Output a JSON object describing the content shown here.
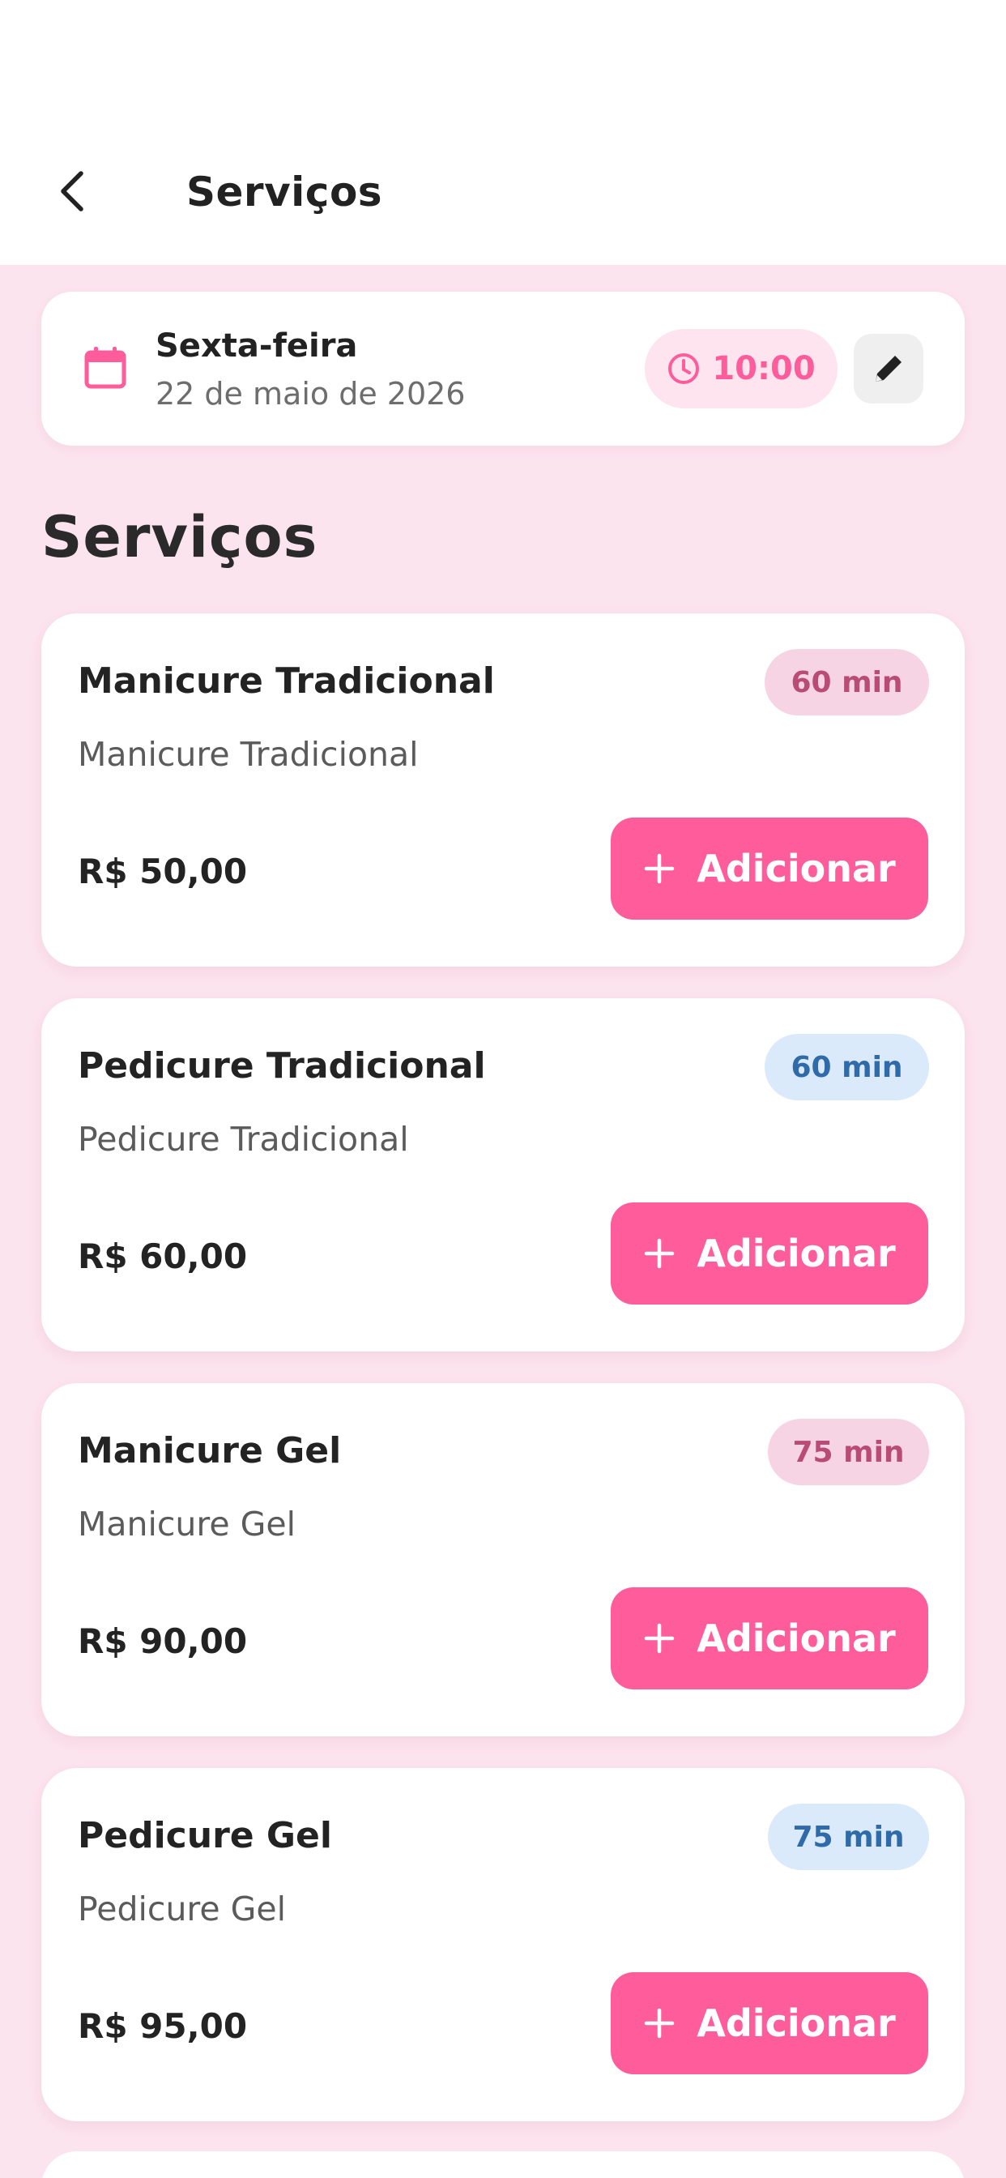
{
  "header": {
    "title": "Serviços",
    "back_icon": "chevron-left-icon"
  },
  "date_card": {
    "weekday": "Sexta-feira",
    "date": "22 de maio de 2026",
    "time": "10:00",
    "calendar_icon": "calendar-icon",
    "clock_icon": "clock-icon",
    "edit_icon": "pencil-icon"
  },
  "section_title": "Serviços",
  "services": [
    {
      "name": "Manicure Tradicional",
      "description": "Manicure Tradicional",
      "duration": "60 min",
      "duration_style": "pink",
      "price": "R$ 50,00",
      "button_label": "Adicionar"
    },
    {
      "name": "Pedicure Tradicional",
      "description": "Pedicure Tradicional",
      "duration": "60 min",
      "duration_style": "blue",
      "price": "R$ 60,00",
      "button_label": "Adicionar"
    },
    {
      "name": "Manicure Gel",
      "description": "Manicure Gel",
      "duration": "75 min",
      "duration_style": "pink",
      "price": "R$ 90,00",
      "button_label": "Adicionar"
    },
    {
      "name": "Pedicure Gel",
      "description": "Pedicure Gel",
      "duration": "75 min",
      "duration_style": "blue",
      "price": "R$ 95,00",
      "button_label": "Adicionar"
    }
  ],
  "colors": {
    "accent": "#ff5c9c",
    "background": "#fce4ee",
    "duration_pink_bg": "#f7d4e3",
    "duration_pink_text": "#b84c76",
    "duration_blue_bg": "#dbeafb",
    "duration_blue_text": "#2f6aa9"
  }
}
